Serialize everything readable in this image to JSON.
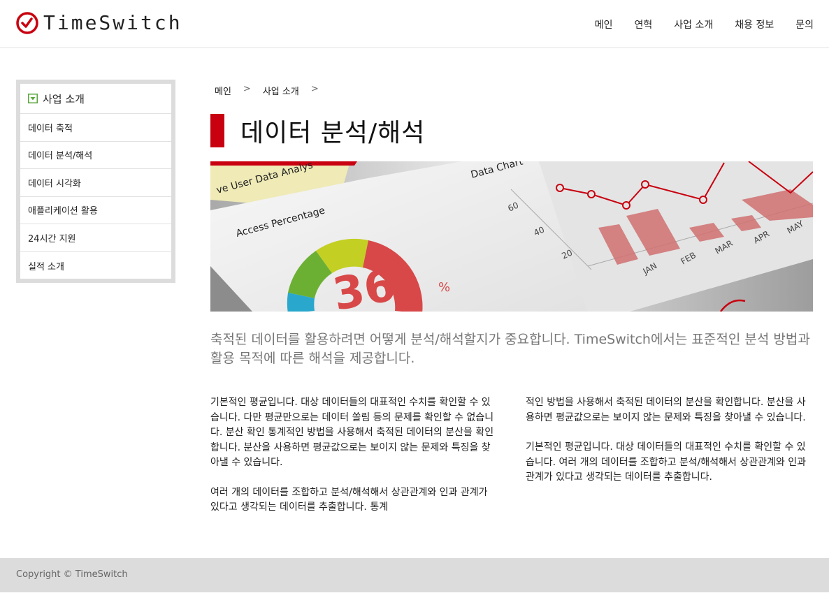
{
  "brand": {
    "name": "TimeSwitch",
    "accent": "#c8000f"
  },
  "nav": [
    {
      "label": "메인"
    },
    {
      "label": "연혁"
    },
    {
      "label": "사업 소개"
    },
    {
      "label": "채용 정보"
    },
    {
      "label": "문의"
    }
  ],
  "sidebar": {
    "heading": "사업 소개",
    "heading_icon": "dropdown-square-icon",
    "items": [
      {
        "label": "데이터 축적"
      },
      {
        "label": "데이터 분석/해석"
      },
      {
        "label": "데이터 시각화"
      },
      {
        "label": "애플리케이션 활용"
      },
      {
        "label": "24시간 지원"
      },
      {
        "label": "실적 소개"
      }
    ]
  },
  "breadcrumb": {
    "items": [
      "메인",
      "사업 소개"
    ],
    "separator": ">"
  },
  "page": {
    "title": "데이터 분석/해석",
    "hero_image_texts": {
      "banner": "ve User Data Analys",
      "chart_title": "Data Chart",
      "donut_title": "Access Percentage",
      "donut_value": "36",
      "donut_unit": "%",
      "y_ticks": [
        "60",
        "40",
        "20"
      ],
      "months": [
        "JAN",
        "FEB",
        "MAR",
        "APR",
        "MAY"
      ]
    },
    "lead": "축적된 데이터를 활용하려면 어떻게 분석/해석할지가 중요합니다. TimeSwitch에서는 표준적인 분석 방법과 활용 목적에 따른 해석을 제공합니다.",
    "left_paragraphs": [
      "기본적인 평균입니다. 대상 데이터들의 대표적인 수치를 확인할 수 있습니다. 다만 평균만으로는 데이터 쏠림 등의 문제를 확인할 수 없습니다. 분산 확인 통계적인 방법을 사용해서 축적된 데이터의 분산을 확인합니다. 분산을 사용하면 평균값으로는 보이지 않는 문제와 특징을 찾아낼 수 있습니다.",
      "여러 개의 데이터를 조합하고 분석/해석해서 상관관계와 인과 관계가 있다고 생각되는 데이터를 추출합니다. 통계"
    ],
    "right_paragraphs": [
      "적인 방법을 사용해서 축적된 데이터의 분산을 확인합니다. 분산을 사용하면 평균값으로는 보이지 않는 문제와 특징을 찾아낼 수 있습니다.",
      "기본적인 평균입니다. 대상 데이터들의 대표적인 수치를 확인할 수 있습니다. 여러 개의 데이터를 조합하고 분석/해석해서 상관관계와 인과 관계가 있다고 생각되는 데이터를 추출합니다."
    ]
  },
  "footer": {
    "copyright": "Copyright © TimeSwitch"
  }
}
